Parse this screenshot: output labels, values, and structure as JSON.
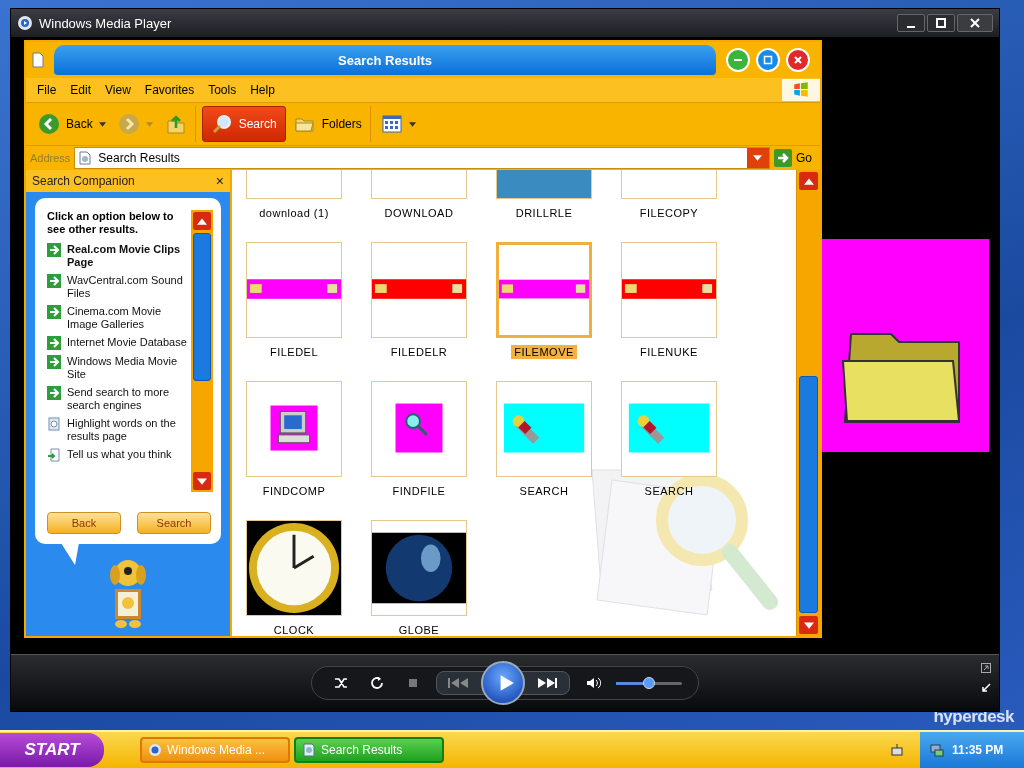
{
  "player": {
    "title": "Windows Media Player",
    "volume": {
      "level": 0.5
    }
  },
  "explorer": {
    "title": "Search Results",
    "menu": [
      "File",
      "Edit",
      "View",
      "Favorites",
      "Tools",
      "Help"
    ],
    "toolbar": [
      {
        "kind": "back",
        "label": "Back"
      },
      {
        "kind": "forward"
      },
      {
        "kind": "up"
      },
      {
        "kind": "search",
        "label": "Search",
        "selected": true
      },
      {
        "kind": "folders",
        "label": "Folders",
        "selected": false
      },
      {
        "kind": "views"
      }
    ],
    "address": {
      "label": "Address",
      "value": "Search Results",
      "go": "Go"
    },
    "companion": {
      "title": "Search Companion",
      "close": "×",
      "prompt": "Click an option below to see other results.",
      "options": [
        {
          "kind": "arrow",
          "text": "Real.com Movie Clips Page",
          "bold": true
        },
        {
          "kind": "arrow",
          "text": "WavCentral.com Sound Files",
          "bold": false
        },
        {
          "kind": "arrow",
          "text": "Cinema.com Movie Image Galleries",
          "bold": false
        },
        {
          "kind": "arrow",
          "text": "Internet Movie Database",
          "bold": false
        },
        {
          "kind": "arrow",
          "text": "Windows Media Movie Site",
          "bold": false
        },
        {
          "kind": "arrow",
          "text": "Send search to more search engines",
          "bold": false
        },
        {
          "kind": "highlight",
          "text": "Highlight words on the results page",
          "bold": false
        },
        {
          "kind": "feedback",
          "text": "Tell us what you think",
          "bold": false
        }
      ],
      "buttons": [
        "Back",
        "Search"
      ]
    },
    "files": [
      {
        "name": "download (1)",
        "kind": "blank",
        "selected": false
      },
      {
        "name": "DOWNLOAD",
        "kind": "blank",
        "selected": false
      },
      {
        "name": "DRILLRLE",
        "kind": "drill",
        "selected": false
      },
      {
        "name": "FILECOPY",
        "kind": "blank",
        "selected": false
      },
      {
        "name": "FILEDEL",
        "kind": "band",
        "color": "#ff00ff",
        "selected": false
      },
      {
        "name": "FILEDELR",
        "kind": "band",
        "color": "#ff0000",
        "selected": false
      },
      {
        "name": "FILEMOVE",
        "kind": "band",
        "color": "#ff00ff",
        "selected": true
      },
      {
        "name": "FILENUKE",
        "kind": "band",
        "color": "#ff0000",
        "selected": false
      },
      {
        "name": "FINDCOMP",
        "kind": "computer",
        "color": "#ff00ff",
        "selected": false
      },
      {
        "name": "FINDFILE",
        "kind": "magnifier",
        "color": "#ff00ff",
        "selected": false
      },
      {
        "name": "SEARCH",
        "kind": "flashlight",
        "color": "#00ffff",
        "selected": false
      },
      {
        "name": "SEARCH",
        "kind": "flashlight",
        "color": "#00ffff",
        "selected": false
      },
      {
        "name": "CLOCK",
        "kind": "clock",
        "selected": false
      },
      {
        "name": "GLOBE",
        "kind": "globe",
        "selected": false
      }
    ]
  },
  "desktop": {
    "logo": "hyperdesk"
  },
  "taskbar": {
    "start": "START",
    "tasks": [
      {
        "label": "Windows Media ...",
        "selected": false
      },
      {
        "label": "Search Results",
        "selected": true
      }
    ],
    "clock": "11:35 PM"
  }
}
